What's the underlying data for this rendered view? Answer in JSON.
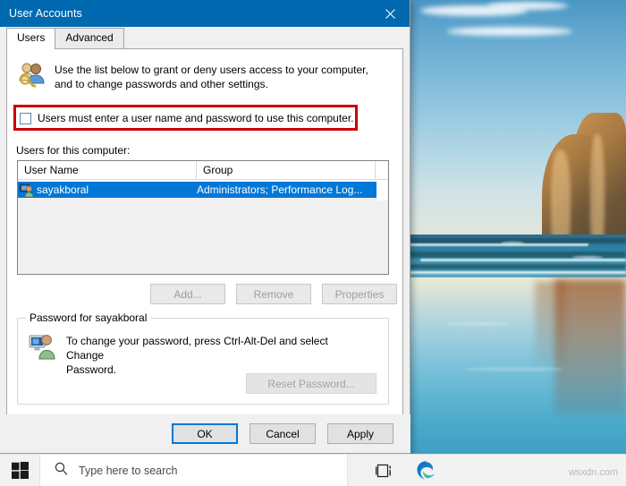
{
  "window": {
    "title": "User Accounts",
    "close_icon": "close-icon"
  },
  "tabs": [
    {
      "label": "Users",
      "active": true
    },
    {
      "label": "Advanced",
      "active": false
    }
  ],
  "users_tab": {
    "intro_icon": "users-key-icon",
    "intro_line1": "Use the list below to grant or deny users access to your computer,",
    "intro_line2": "and to change passwords and other settings.",
    "checkbox": {
      "label": "Users must enter a user name and password to use this computer.",
      "checked": false,
      "highlight_color": "#cc0000"
    },
    "list_label": "Users for this computer:",
    "list": {
      "columns": [
        "User Name",
        "Group"
      ],
      "rows": [
        {
          "icon": "user-account-icon",
          "user_name": "sayakboral",
          "group": "Administrators; Performance Log...",
          "selected": true,
          "selection_color": "#0078d7"
        }
      ]
    },
    "buttons": [
      {
        "label": "Add...",
        "enabled": false
      },
      {
        "label": "Remove",
        "enabled": false
      },
      {
        "label": "Properties",
        "enabled": false
      }
    ],
    "password_group": {
      "title": "Password for sayakboral",
      "icon": "user-monitor-icon",
      "text_line1": "To change your password, press Ctrl-Alt-Del and select Change",
      "text_line2": "Password.",
      "reset_button": {
        "label": "Reset Password...",
        "enabled": false
      }
    }
  },
  "dialog_buttons": [
    {
      "label": "OK",
      "default": true
    },
    {
      "label": "Cancel",
      "default": false
    },
    {
      "label": "Apply",
      "default": false
    }
  ],
  "taskbar": {
    "start_icon": "windows-start-icon",
    "search": {
      "placeholder": "Type here to search",
      "icon": "search-icon"
    },
    "task_view_icon": "task-view-icon",
    "edge_icon": "microsoft-edge-icon"
  },
  "watermark": "wsxdn.com"
}
